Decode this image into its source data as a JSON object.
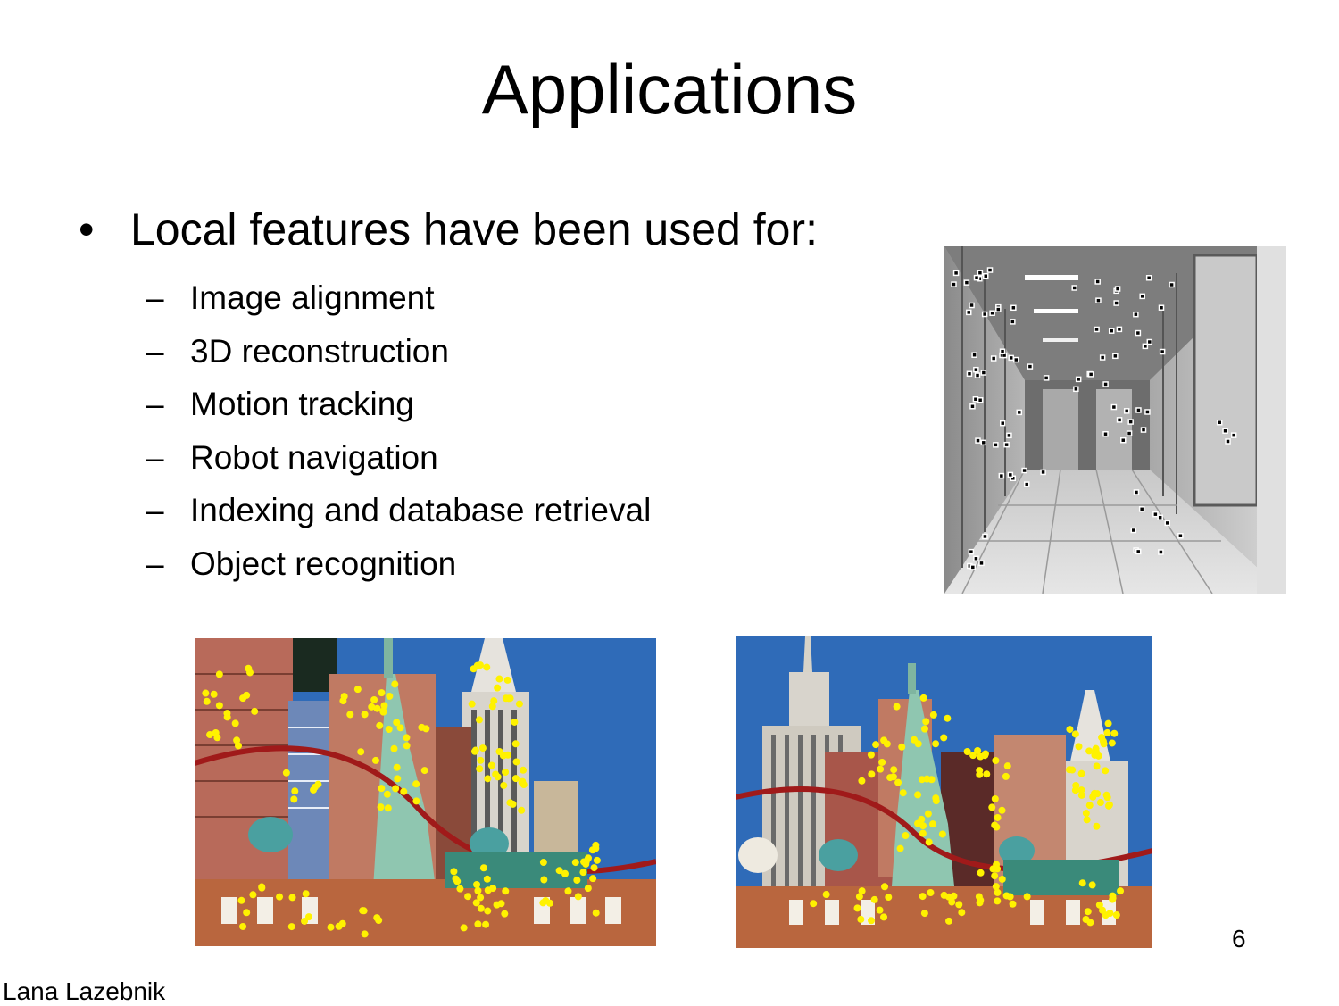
{
  "slide": {
    "title": "Applications",
    "bullet": "Local features have been used for:",
    "bullet_marker": "•",
    "sub_marker": "–",
    "sub_items": [
      "Image alignment",
      "3D reconstruction",
      "Motion tracking",
      "Robot navigation",
      "Indexing and database retrieval",
      "Object recognition"
    ],
    "page_number": "6",
    "author": "Lana Lazebnik"
  },
  "images": {
    "corridor": "grayscale corridor photo with detected feature points",
    "scene_left": "Las Vegas New York-New York skyline with yellow feature points",
    "scene_right": "Las Vegas New York-New York skyline, second view, with yellow feature points"
  },
  "colors": {
    "feature_point_color": "#fff200",
    "sky": "#2f6bb8"
  }
}
